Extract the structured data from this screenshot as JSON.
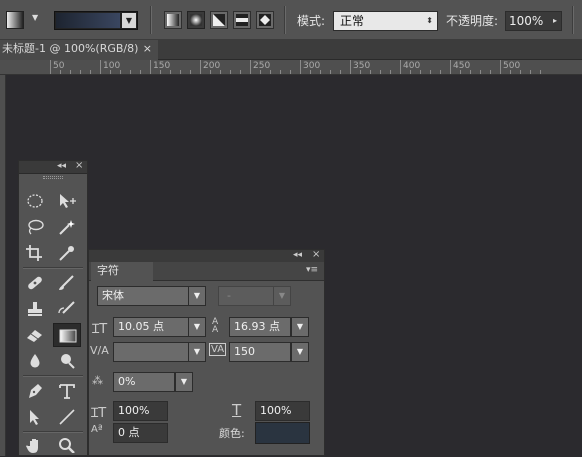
{
  "options_bar": {
    "gradient_type_buttons": [
      {
        "name": "linear",
        "selected": false
      },
      {
        "name": "radial",
        "selected": true
      },
      {
        "name": "angle",
        "selected": false
      },
      {
        "name": "reflected",
        "selected": false
      },
      {
        "name": "diamond",
        "selected": false
      }
    ],
    "mode_label": "模式:",
    "mode_value": "正常",
    "opacity_label": "不透明度:",
    "opacity_value": "100%"
  },
  "document_tab": {
    "title": "未标题-1 @ 100%(RGB/8)",
    "close_glyph": "×"
  },
  "ruler_labels": [
    "50",
    "100",
    "150",
    "200",
    "250",
    "300",
    "350",
    "400",
    "450",
    "500"
  ],
  "tools_panel": {
    "collapse_glyph": "◂◂",
    "close_glyph": "×",
    "tools": [
      {
        "name": "elliptical-marquee-tool",
        "selected": false
      },
      {
        "name": "move-tool",
        "selected": false
      },
      {
        "name": "lasso-tool",
        "selected": false
      },
      {
        "name": "magic-wand-tool",
        "selected": false
      },
      {
        "name": "crop-tool",
        "selected": false
      },
      {
        "name": "eyedropper-tool",
        "selected": false
      },
      {
        "name": "spot-healing-brush-tool",
        "selected": false
      },
      {
        "name": "brush-tool",
        "selected": false
      },
      {
        "name": "clone-stamp-tool",
        "selected": false
      },
      {
        "name": "history-brush-tool",
        "selected": false
      },
      {
        "name": "eraser-tool",
        "selected": false
      },
      {
        "name": "gradient-tool",
        "selected": true
      },
      {
        "name": "blur-tool",
        "selected": false
      },
      {
        "name": "dodge-tool",
        "selected": false
      },
      {
        "name": "pen-tool",
        "selected": false
      },
      {
        "name": "type-tool",
        "selected": false
      },
      {
        "name": "path-selection-tool",
        "selected": false
      },
      {
        "name": "line-tool",
        "selected": false
      },
      {
        "name": "hand-tool",
        "selected": false
      },
      {
        "name": "zoom-tool",
        "selected": false
      }
    ]
  },
  "character_panel": {
    "collapse_glyph": "◂◂",
    "close_glyph": "×",
    "tab_label": "字符",
    "font_family": "宋体",
    "font_style": "-",
    "font_size": "10.05 点",
    "leading": "16.93 点",
    "kerning": "",
    "tracking": "150",
    "tsume": "0%",
    "vertical_scale": "100%",
    "horizontal_scale": "100%",
    "baseline_shift": "0 点",
    "color_label": "颜色:",
    "color_value": "#2a3440"
  },
  "colors": {
    "canvas": "#2b2a2e",
    "panel": "#535353"
  }
}
